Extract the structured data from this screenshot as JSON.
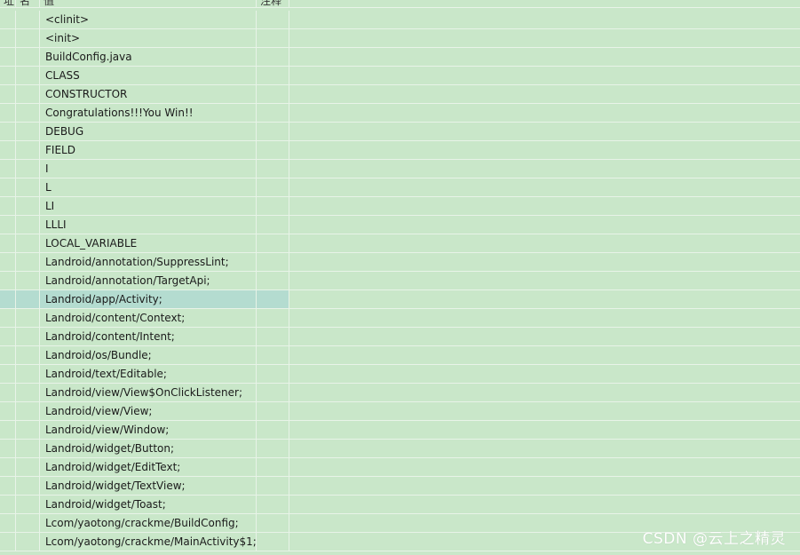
{
  "header": {
    "col_a": "址",
    "col_b": "名",
    "col_c": "值",
    "col_d": "注释"
  },
  "rows": [
    {
      "value": "<clinit>"
    },
    {
      "value": "<init>"
    },
    {
      "value": "BuildConfig.java"
    },
    {
      "value": "CLASS"
    },
    {
      "value": "CONSTRUCTOR"
    },
    {
      "value": "Congratulations!!!You Win!!"
    },
    {
      "value": "DEBUG"
    },
    {
      "value": "FIELD"
    },
    {
      "value": "I"
    },
    {
      "value": "L"
    },
    {
      "value": "LI"
    },
    {
      "value": "LLLI"
    },
    {
      "value": "LOCAL_VARIABLE"
    },
    {
      "value": "Landroid/annotation/SuppressLint;"
    },
    {
      "value": "Landroid/annotation/TargetApi;"
    },
    {
      "value": "Landroid/app/Activity;",
      "selected": true
    },
    {
      "value": "Landroid/content/Context;"
    },
    {
      "value": "Landroid/content/Intent;"
    },
    {
      "value": "Landroid/os/Bundle;"
    },
    {
      "value": "Landroid/text/Editable;"
    },
    {
      "value": "Landroid/view/View$OnClickListener;"
    },
    {
      "value": "Landroid/view/View;"
    },
    {
      "value": "Landroid/view/Window;"
    },
    {
      "value": "Landroid/widget/Button;"
    },
    {
      "value": "Landroid/widget/EditText;"
    },
    {
      "value": "Landroid/widget/TextView;"
    },
    {
      "value": "Landroid/widget/Toast;"
    },
    {
      "value": "Lcom/yaotong/crackme/BuildConfig;"
    },
    {
      "value": "Lcom/yaotong/crackme/MainActivity$1;"
    }
  ],
  "watermark": "CSDN @云上之精灵",
  "colors": {
    "background": "#c9e7c9",
    "selected_row": "#b4dcd0",
    "grid_line": "#e8f3e8"
  }
}
